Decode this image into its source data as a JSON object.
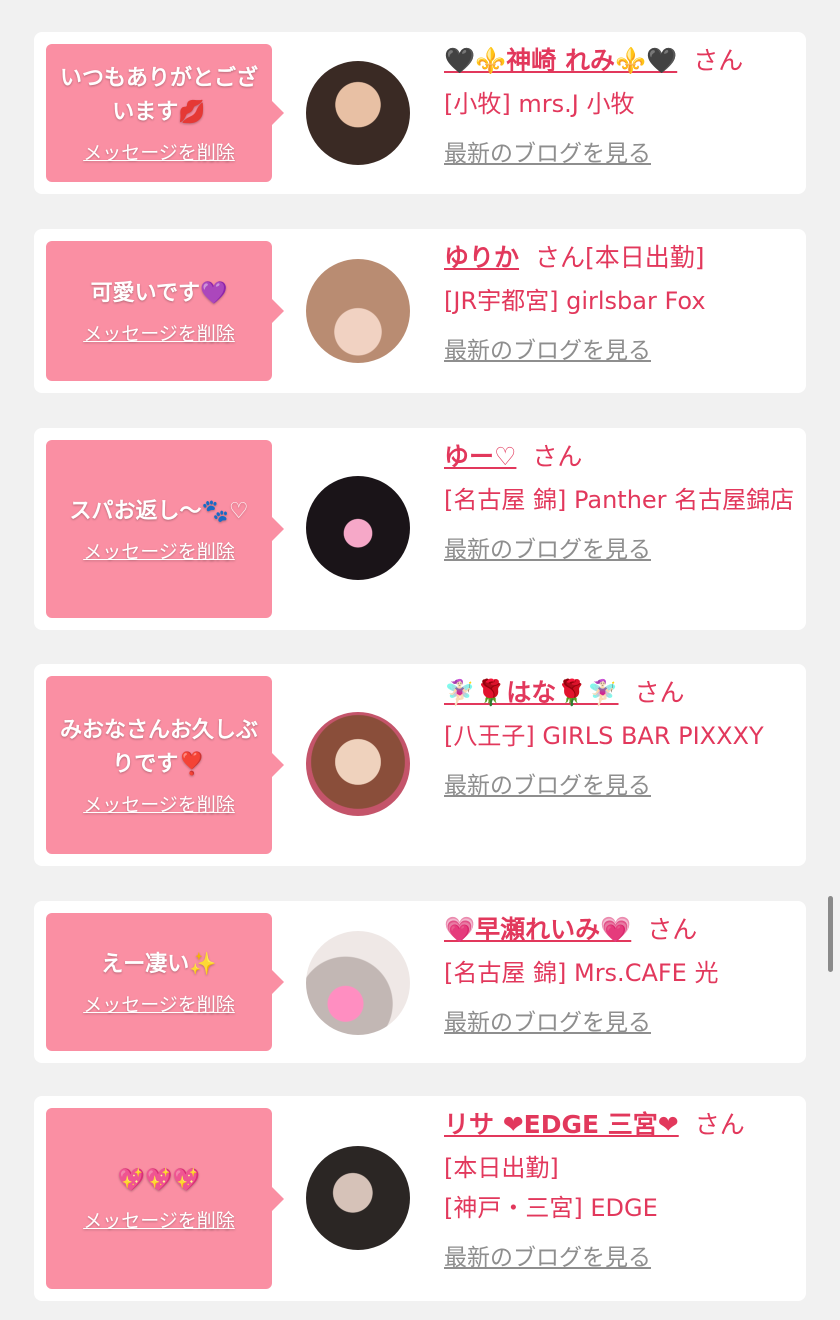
{
  "san_label": "さん",
  "delete_label": "メッセージを削除",
  "blog_label": "最新のブログを見る",
  "accent_color": "#e2385c",
  "bubble_color": "#fa8fa3",
  "cards": [
    {
      "message": "いつもありがとございます💋",
      "name": "🖤⚜️神崎 れみ⚜️🖤",
      "tag": "",
      "shop": "[小牧] mrs.J 小牧",
      "avatar": "woman-dark-hair-heart-sticker"
    },
    {
      "message": "可愛いです💜",
      "name": "ゆりか",
      "tag": "[本日出勤]",
      "shop": "[JR宇都宮] girlsbar Fox",
      "avatar": "woman-bangs-closeup"
    },
    {
      "message": "スパお返し〜🐾♡",
      "name": "ゆー♡",
      "tag": "",
      "shop": "[名古屋 錦] Panther 名古屋錦店",
      "avatar": "woman-cat-ears-heart-sticker"
    },
    {
      "message": "みおなさんお久しぶりです❣️",
      "name": "🧚🏻‍♀️🌹はな🌹🧚🏻‍♀️",
      "tag": "",
      "shop": "[八王子] GIRLS BAR PIXXXY",
      "avatar": "woman-brown-hair-choker"
    },
    {
      "message": "えー凄い✨",
      "name": "💗早瀬れいみ💗",
      "tag": "",
      "shop": "[名古屋 錦] Mrs.CAFE 光",
      "avatar": "woman-heart-sticker-face"
    },
    {
      "message": "💖💖💖",
      "name": "リサ ❤EDGE 三宮❤",
      "tag": "",
      "shop": "[本日出勤]\n[神戸・三宮] EDGE",
      "avatar": "woman-long-dark-hair"
    }
  ]
}
